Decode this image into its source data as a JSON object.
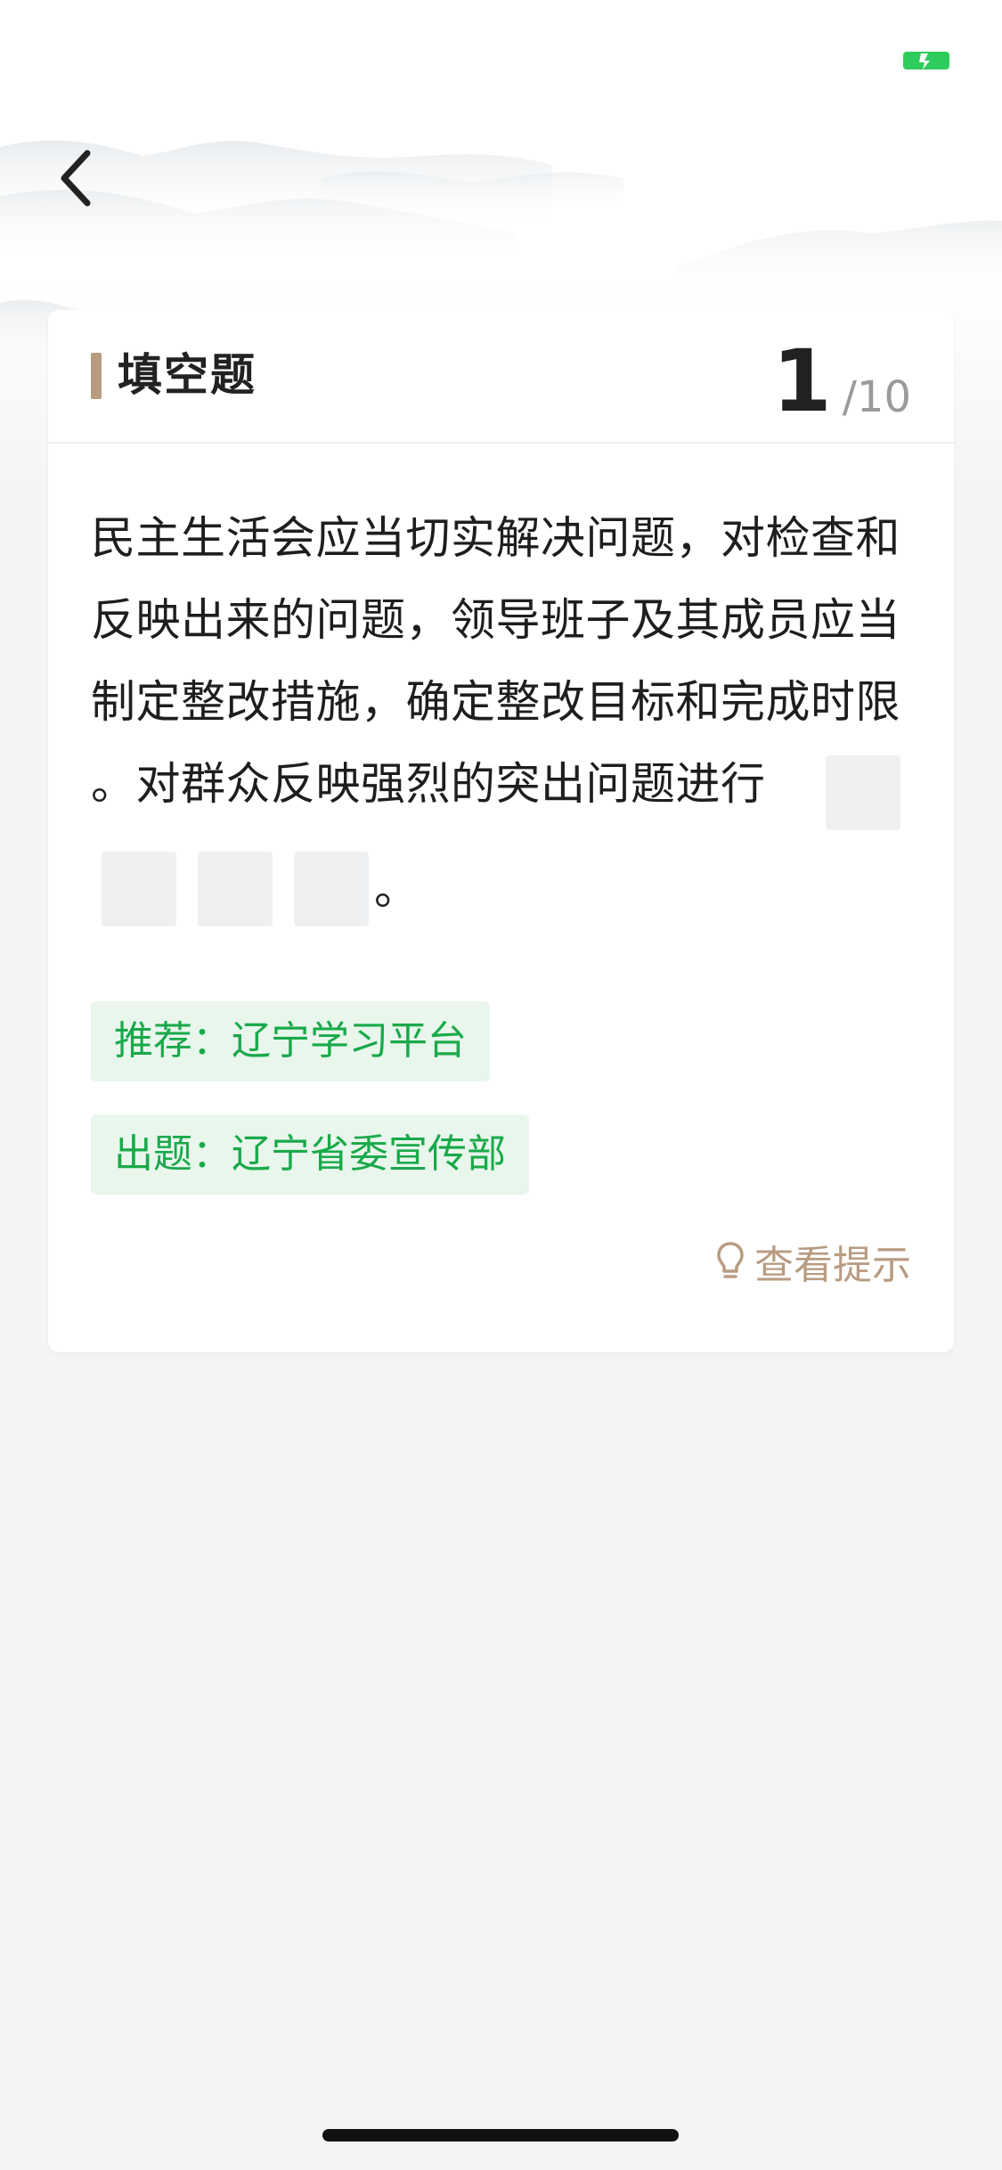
{
  "header": {
    "title": "填空题",
    "current": "1",
    "total": "/10"
  },
  "question": {
    "lines": [
      "民主生活会应当切实解决问题，对检查和",
      "反映出来的问题，领导班子及其成员应当",
      "制定整改措施，确定整改目标和完成时限",
      "。对群众反映强烈的突出问题进行"
    ],
    "tail": "。"
  },
  "tags": {
    "recommend": "推荐：辽宁学习平台",
    "source": "出题：辽宁省委宣传部"
  },
  "hint": {
    "label": "查看提示",
    "icon": "lightbulb-icon"
  },
  "icons": {
    "back": "chevron-left-icon",
    "status": "battery-charging-icon"
  },
  "colors": {
    "accent": "#b89c82",
    "tag_text": "#19a94a",
    "tag_bg": "#e8f6ec",
    "status_green": "#2ecc5c"
  }
}
